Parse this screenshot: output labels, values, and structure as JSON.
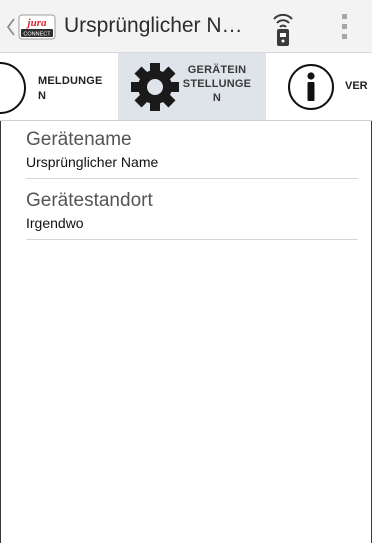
{
  "app_bar": {
    "title": "Ursprünglicher N…",
    "logo": {
      "brand": "jura",
      "caption": "CONNECT"
    },
    "actions": [
      "remote-control-icon",
      "overflow-menu-icon"
    ]
  },
  "tabs": [
    {
      "label": "MELDUNGE\nN",
      "icon": "none",
      "selected": false
    },
    {
      "label": "GERÄTEIN\nSTELLUNGE\nN",
      "icon": "gear-icon",
      "selected": true
    },
    {
      "label": "VER",
      "icon": "info-icon",
      "selected": false
    }
  ],
  "fields": [
    {
      "label": "Gerätename",
      "value": "Ursprünglicher Name"
    },
    {
      "label": "Gerätestandort",
      "value": "Irgendwo"
    }
  ],
  "colors": {
    "action_bar_bg": "#f3f3f3",
    "selected_tab_bg": "#dfe4ea",
    "brand_red": "#d9262f",
    "divider": "#d5d5d5"
  }
}
